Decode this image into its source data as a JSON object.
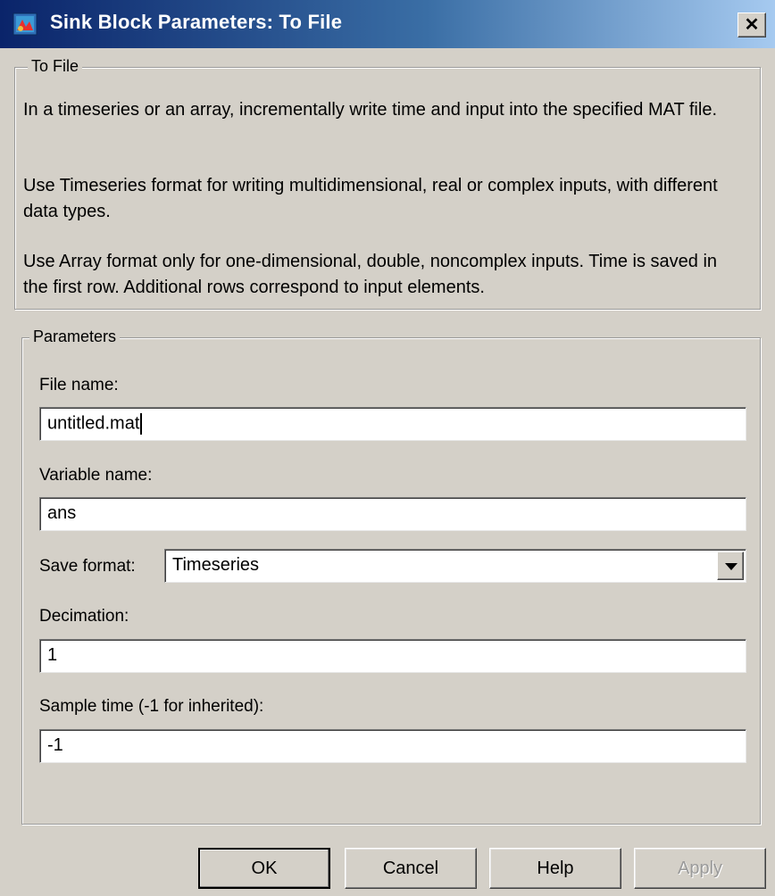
{
  "window": {
    "title": "Sink Block Parameters: To File",
    "close_label": "✕"
  },
  "description": {
    "group_label": "To File",
    "paragraphs": [
      "In a timeseries or an array, incrementally write time and input into the specified MAT file.",
      "Use Timeseries format for writing multidimensional, real or complex inputs, with different data types.",
      "Use Array format only for one-dimensional, double, noncomplex inputs. Time is saved in the first row.  Additional rows correspond to input elements."
    ]
  },
  "parameters": {
    "group_label": "Parameters",
    "file_name": {
      "label": "File name:",
      "value": "untitled.mat"
    },
    "variable_name": {
      "label": "Variable name:",
      "value": "ans"
    },
    "save_format": {
      "label": "Save format:",
      "value": "Timeseries"
    },
    "decimation": {
      "label": "Decimation:",
      "value": "1"
    },
    "sample_time": {
      "label": "Sample time (-1 for inherited):",
      "value": "-1"
    }
  },
  "buttons": {
    "ok": "OK",
    "cancel": "Cancel",
    "help": "Help",
    "apply": "Apply"
  }
}
